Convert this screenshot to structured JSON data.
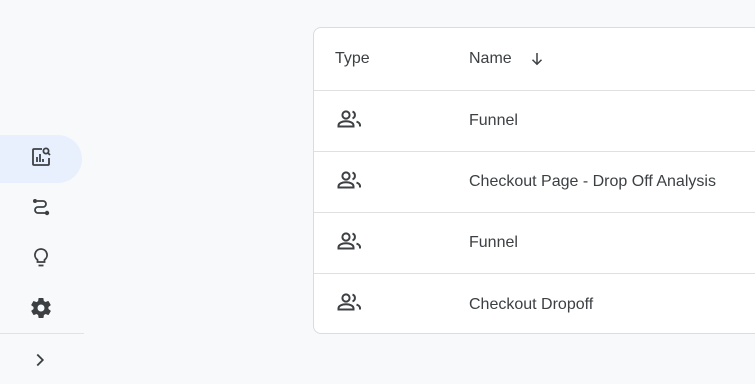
{
  "table": {
    "headers": {
      "type": "Type",
      "name": "Name"
    },
    "rows": [
      {
        "type_icon": "people-icon",
        "name": "Funnel"
      },
      {
        "type_icon": "people-icon",
        "name": "Checkout Page - Drop Off Analysis"
      },
      {
        "type_icon": "people-icon",
        "name": "Funnel"
      },
      {
        "type_icon": "people-icon",
        "name": "Checkout Dropoff"
      }
    ],
    "sort": {
      "column": "name",
      "direction": "descending",
      "icon": "arrow-down-icon"
    }
  },
  "nav_rail": {
    "items": [
      {
        "icon": "explore-report-icon",
        "active": true
      },
      {
        "icon": "path-icon",
        "active": false
      },
      {
        "icon": "lightbulb-icon",
        "active": false
      },
      {
        "icon": "gear-icon",
        "active": false
      }
    ],
    "expand_icon": "chevron-right-icon"
  },
  "colors": {
    "active_bg": "#e8f0fe",
    "text": "#3c4043",
    "border": "#dadce0"
  }
}
